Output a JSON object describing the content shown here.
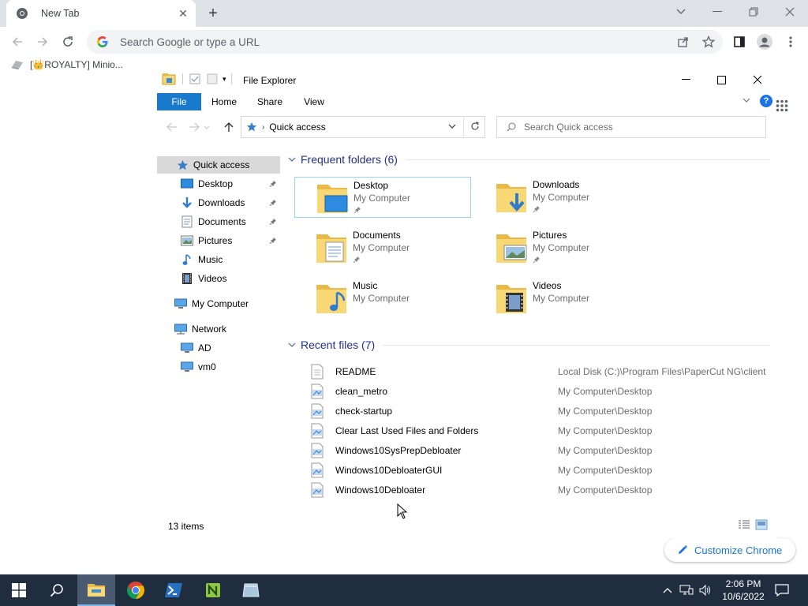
{
  "browser": {
    "tab_title": "New Tab",
    "omnibox_placeholder": "Search Google or type a URL",
    "bookmark": "[👑ROYALTY] Minio...",
    "customize_label": "Customize Chrome"
  },
  "explorer": {
    "title": "File Explorer",
    "ribbon_tabs": [
      "File",
      "Home",
      "Share",
      "View"
    ],
    "address": "Quick access",
    "search_placeholder": "Search Quick access",
    "nav": {
      "quick_access": "Quick access",
      "desktop": "Desktop",
      "downloads": "Downloads",
      "documents": "Documents",
      "pictures": "Pictures",
      "music": "Music",
      "videos": "Videos",
      "my_computer": "My Computer",
      "network": "Network",
      "ad": "AD",
      "vm0": "vm0"
    },
    "frequent_header": "Frequent folders (6)",
    "folders": [
      {
        "name": "Desktop",
        "location": "My Computer",
        "pinned": true
      },
      {
        "name": "Downloads",
        "location": "My Computer",
        "pinned": true
      },
      {
        "name": "Documents",
        "location": "My Computer",
        "pinned": true
      },
      {
        "name": "Pictures",
        "location": "My Computer",
        "pinned": true
      },
      {
        "name": "Music",
        "location": "My Computer",
        "pinned": false
      },
      {
        "name": "Videos",
        "location": "My Computer",
        "pinned": false
      }
    ],
    "recent_header": "Recent files (7)",
    "recent_files": [
      {
        "name": "README",
        "path": "Local Disk (C:)\\Program Files\\PaperCut NG\\client"
      },
      {
        "name": "clean_metro",
        "path": "My Computer\\Desktop"
      },
      {
        "name": "check-startup",
        "path": "My Computer\\Desktop"
      },
      {
        "name": "Clear Last Used Files and Folders",
        "path": "My Computer\\Desktop"
      },
      {
        "name": "Windows10SysPrepDebloater",
        "path": "My Computer\\Desktop"
      },
      {
        "name": "Windows10DebloaterGUI",
        "path": "My Computer\\Desktop"
      },
      {
        "name": "Windows10Debloater",
        "path": "My Computer\\Desktop"
      }
    ],
    "status": "13 items"
  },
  "taskbar": {
    "time": "2:06 PM",
    "date": "10/6/2022"
  },
  "colors": {
    "accent_blue": "#1979ca",
    "folder_yellow": "#f8d775",
    "taskbar": "#1f2d3f"
  }
}
